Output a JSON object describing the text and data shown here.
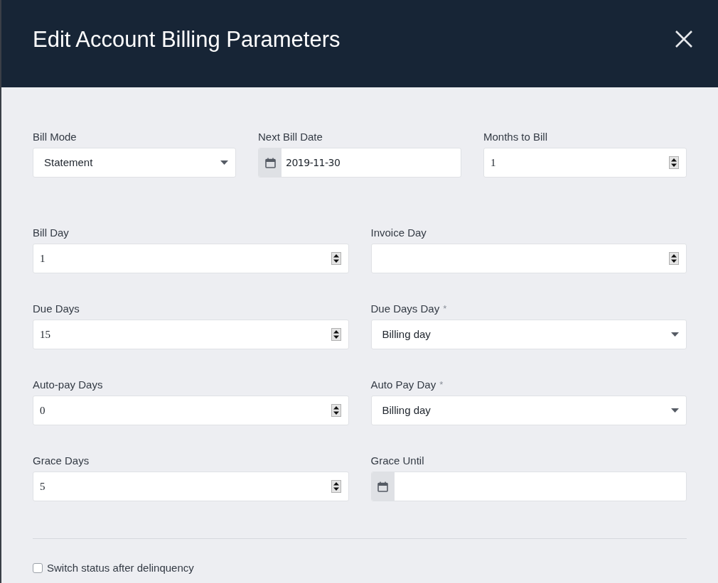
{
  "dialog": {
    "title": "Edit Account Billing Parameters"
  },
  "rows": [
    {
      "fields": [
        {
          "label": "Bill Mode",
          "kind": "select",
          "value": "Statement"
        },
        {
          "label": "Next Bill Date",
          "kind": "date",
          "value": "2019-11-30"
        },
        {
          "label": "Months to Bill",
          "kind": "number",
          "value": "1"
        }
      ]
    },
    {
      "fields": [
        {
          "label": "Bill Day",
          "kind": "number",
          "value": "1"
        },
        {
          "label": "Invoice Day",
          "kind": "number"
        }
      ]
    },
    {
      "fields": [
        {
          "label": "Due Days",
          "kind": "number",
          "value": "15"
        },
        {
          "label": "Due Days Day",
          "required_mark": "*",
          "kind": "select",
          "value": "Billing day"
        }
      ]
    },
    {
      "fields": [
        {
          "label": "Auto-pay Days",
          "kind": "number",
          "value": "0"
        },
        {
          "label": "Auto Pay Day",
          "required_mark": "*",
          "kind": "select",
          "value": "Billing day"
        }
      ]
    },
    {
      "fields": [
        {
          "label": "Grace Days",
          "kind": "number",
          "value": "5"
        },
        {
          "label": "Grace Until",
          "kind": "date"
        }
      ]
    }
  ],
  "checkbox": {
    "label": "Switch status after delinquency",
    "checked": false
  }
}
